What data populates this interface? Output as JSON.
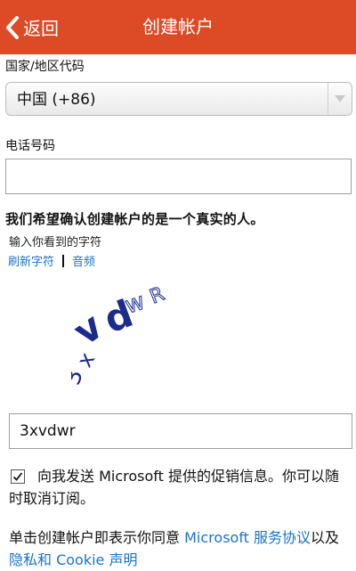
{
  "header": {
    "back_label": "返回",
    "title": "创建帐户",
    "color": "#dc4a26"
  },
  "country": {
    "label": "国家/地区代码",
    "selected": "中国 (+86)"
  },
  "phone": {
    "label": "电话号码",
    "value": ""
  },
  "verify": {
    "heading": "我们希望确认创建帐户的是一个真实的人。",
    "instruction": "输入你看到的字符",
    "refresh_link": "刷新字符",
    "audio_link": "音频"
  },
  "captcha": {
    "chars": [
      "3",
      "x",
      "v",
      "d",
      "w",
      "R"
    ]
  },
  "captcha_input": {
    "value": "3xvdwr"
  },
  "promo": {
    "checked": true,
    "text": "向我发送 Microsoft 提供的促销信息。你可以随时取消订阅。"
  },
  "terms": {
    "prefix": "单击",
    "bold": "创建帐户",
    "middle": "即表示你同意 ",
    "link1": "Microsoft 服务协议",
    "and": "以及",
    "link2": "隐私和 Cookie 声明",
    "link_color": "#1a73c9"
  }
}
